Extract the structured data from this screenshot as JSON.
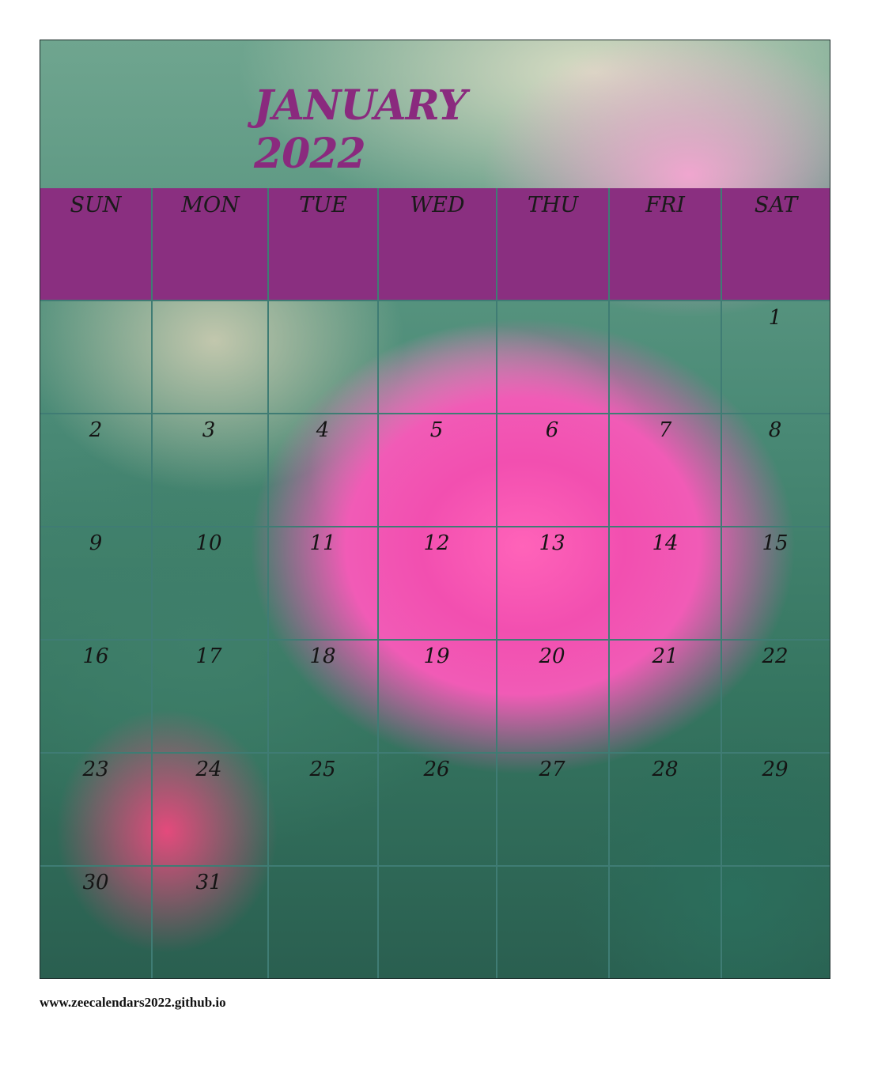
{
  "calendar": {
    "title": "JANUARY 2022",
    "weekdays": [
      "SUN",
      "MON",
      "TUE",
      "WED",
      "THU",
      "FRI",
      "SAT"
    ],
    "weeks": [
      [
        "",
        "",
        "",
        "",
        "",
        "",
        "1"
      ],
      [
        "2",
        "3",
        "4",
        "5",
        "6",
        "7",
        "8"
      ],
      [
        "9",
        "10",
        "11",
        "12",
        "13",
        "14",
        "15"
      ],
      [
        "16",
        "17",
        "18",
        "19",
        "20",
        "21",
        "22"
      ],
      [
        "23",
        "24",
        "25",
        "26",
        "27",
        "28",
        "29"
      ],
      [
        "30",
        "31",
        "",
        "",
        "",
        "",
        ""
      ]
    ],
    "background_image": "pink-rose-photo",
    "colors": {
      "title": "#8a2a7e",
      "header_band": "#8a2f80",
      "grid_lines": "#3f7c74"
    }
  },
  "footer": {
    "url": "www.zeecalendars2022.github.io"
  }
}
